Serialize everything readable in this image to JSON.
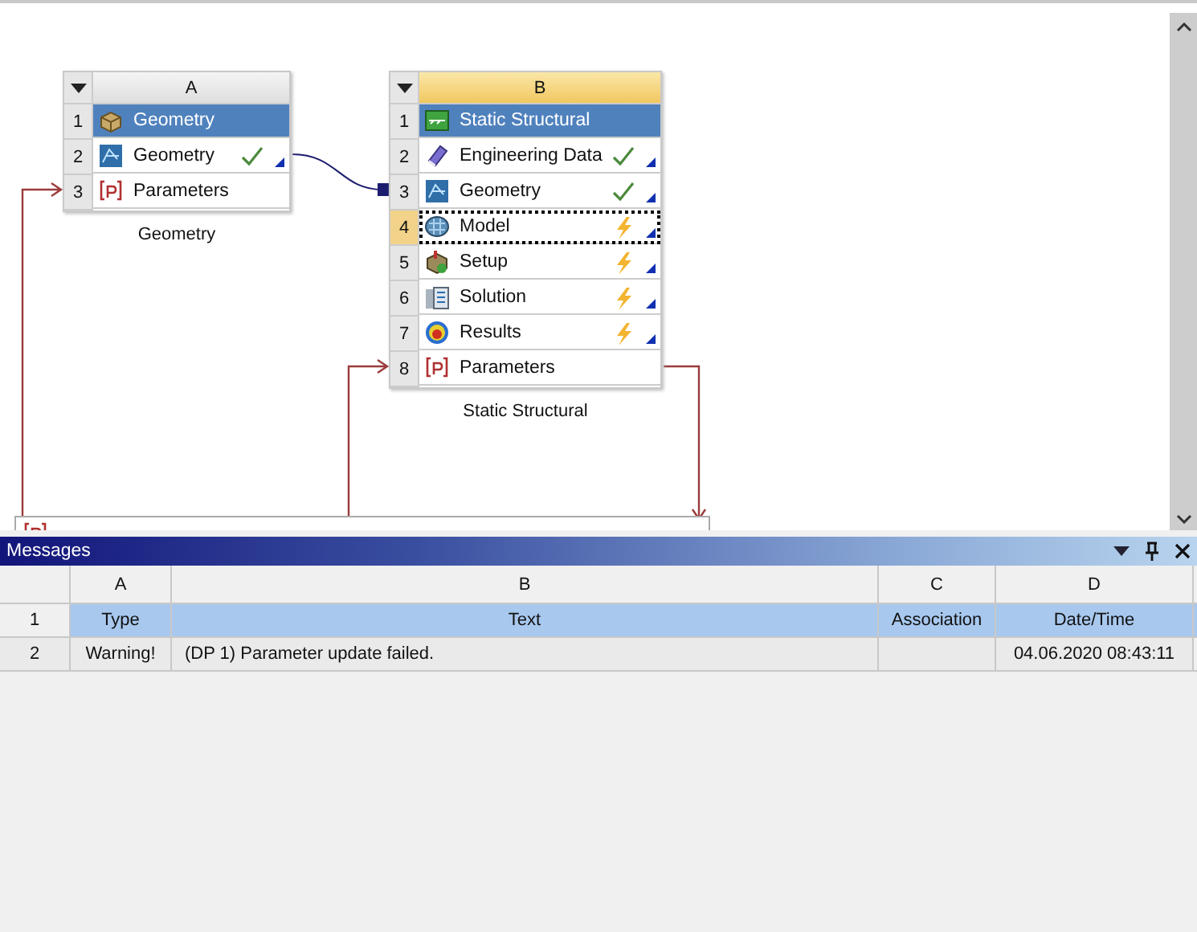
{
  "systems": [
    {
      "letter": "A",
      "selected": false,
      "caption": "Geometry",
      "rows": [
        {
          "number": "1",
          "kind": "geometry-system",
          "label": "Geometry",
          "selected": false,
          "up_to_date": false,
          "needs_update": false
        },
        {
          "number": "2",
          "kind": "geometry",
          "label": "Geometry",
          "selected": false,
          "up_to_date": true,
          "needs_update": false
        },
        {
          "number": "3",
          "kind": "parameters",
          "label": "Parameters",
          "selected": false,
          "up_to_date": false,
          "needs_update": false
        }
      ]
    },
    {
      "letter": "B",
      "selected": true,
      "caption": "Static Structural",
      "rows": [
        {
          "number": "1",
          "kind": "structural-system",
          "label": "Static Structural",
          "selected": false,
          "up_to_date": false,
          "needs_update": false
        },
        {
          "number": "2",
          "kind": "engineering-data",
          "label": "Engineering Data",
          "selected": false,
          "up_to_date": true,
          "needs_update": false
        },
        {
          "number": "3",
          "kind": "geometry",
          "label": "Geometry",
          "selected": false,
          "up_to_date": true,
          "needs_update": false
        },
        {
          "number": "4",
          "kind": "model",
          "label": "Model",
          "selected": true,
          "up_to_date": false,
          "needs_update": true
        },
        {
          "number": "5",
          "kind": "setup",
          "label": "Setup",
          "selected": false,
          "up_to_date": false,
          "needs_update": true
        },
        {
          "number": "6",
          "kind": "solution",
          "label": "Solution",
          "selected": false,
          "up_to_date": false,
          "needs_update": true
        },
        {
          "number": "7",
          "kind": "results",
          "label": "Results",
          "selected": false,
          "up_to_date": false,
          "needs_update": true
        },
        {
          "number": "8",
          "kind": "parameters",
          "label": "Parameters",
          "selected": false,
          "up_to_date": false,
          "needs_update": false
        }
      ]
    }
  ],
  "messages": {
    "title": "Messages",
    "columns": [
      "A",
      "B",
      "C",
      "D"
    ],
    "rows": [
      {
        "number": "1",
        "kind": "header",
        "cells": [
          "Type",
          "Text",
          "Association",
          "Date/Time"
        ]
      },
      {
        "number": "2",
        "kind": "data",
        "cells": [
          "Warning!",
          "(DP 1) Parameter update failed.",
          "",
          "04.06.2020 08:43:11"
        ]
      }
    ]
  }
}
